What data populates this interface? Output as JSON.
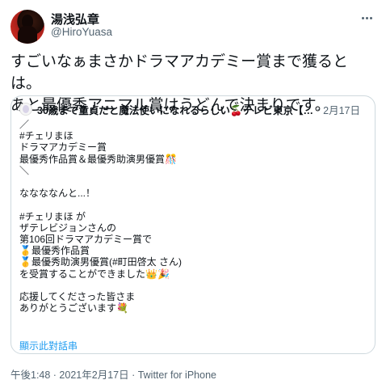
{
  "tweet": {
    "author": {
      "display_name": "湯浅弘章",
      "handle": "@HiroYuasa"
    },
    "text": "すごいなぁまさかドラマアカデミー賞まで獲るとは。\nあと最優秀アニマル賞はうどんで決まりです。",
    "meta": "午後1:48 · 2021年2月17日 · Twitter for iPhone",
    "more_icon": "more-horizontal-icon"
  },
  "quote": {
    "author_name": "30歳まで童貞だと魔法使いになれるらしい🍒テレビ東京【…",
    "separator": "·",
    "date": "2月17日",
    "body": "／\n#チェリまほ\nドラマアカデミー賞\n最優秀作品賞＆最優秀助演男優賞🎊\n＼\n\nななななんと...！\n\n#チェリまほ が\nザテレビジョンさんの\n第106回ドラマアカデミー賞で\n🥇最優秀作品賞\n🥇最優秀助演男優賞(#町田啓太 さん)\nを受賞することができました👑🎉\n\n応援してくださった皆さま\nありがとうございます💐",
    "translate_link": "顯示此對話串"
  },
  "colors": {
    "text": "#0f1419",
    "secondary": "#536471",
    "link": "#1d9bf0",
    "border": "#cfd9de"
  }
}
